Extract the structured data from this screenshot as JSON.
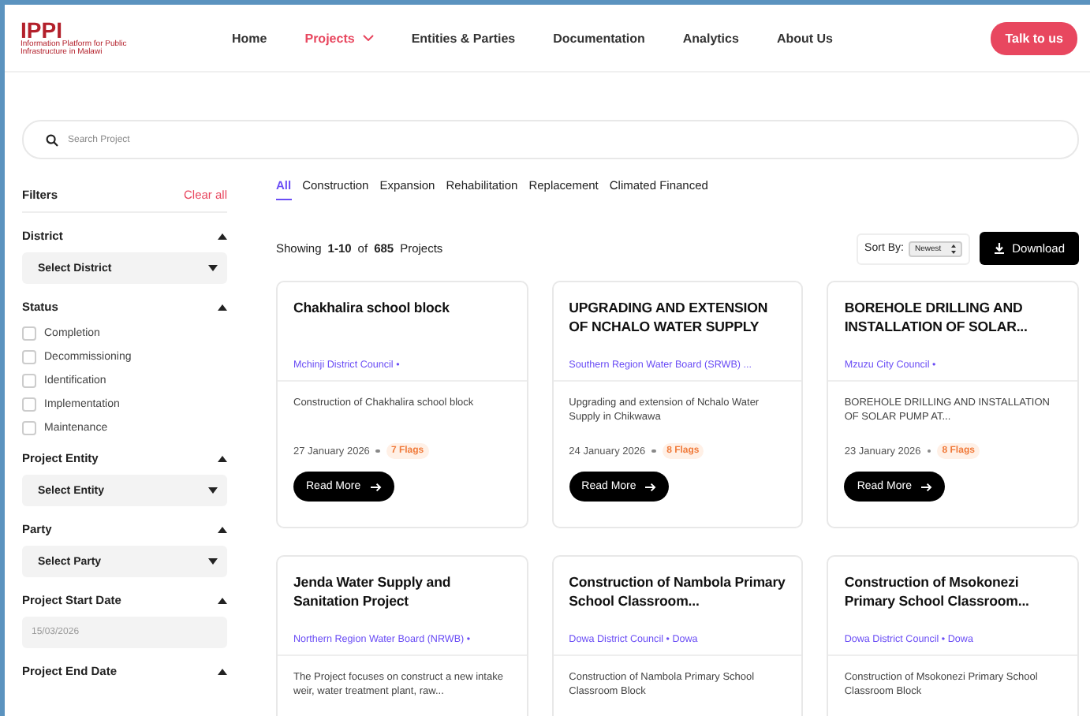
{
  "header": {
    "logo": "IPPI",
    "logo_tagline": "Information Platform for Public Infrastructure in Malawi",
    "nav": [
      {
        "label": "Home",
        "selected": false,
        "dropdown": false
      },
      {
        "label": "Projects",
        "selected": true,
        "dropdown": true
      },
      {
        "label": "Entities & Parties",
        "selected": false,
        "dropdown": false
      },
      {
        "label": "Documentation",
        "selected": false,
        "dropdown": false
      },
      {
        "label": "Analytics",
        "selected": false,
        "dropdown": false
      },
      {
        "label": "About Us",
        "selected": false,
        "dropdown": false
      }
    ],
    "cta": "Talk to us"
  },
  "search": {
    "placeholder": "Search Project"
  },
  "filters": {
    "title": "Filters",
    "clear": "Clear all",
    "sections": [
      {
        "title": "District",
        "expanded": true,
        "kind": "select",
        "value": "Select District"
      },
      {
        "title": "Status",
        "expanded": true,
        "kind": "checkboxes",
        "options": [
          {
            "label": "Completion",
            "checked": false
          },
          {
            "label": "Decommissioning",
            "checked": false
          },
          {
            "label": "Identification",
            "checked": false
          },
          {
            "label": "Implementation",
            "checked": false
          },
          {
            "label": "Maintenance",
            "checked": false
          }
        ]
      },
      {
        "title": "Project Entity",
        "expanded": true,
        "kind": "select",
        "value": "Select Entity"
      },
      {
        "title": "Party",
        "expanded": true,
        "kind": "select",
        "value": "Select Party"
      },
      {
        "title": "Project Start Date",
        "expanded": true,
        "kind": "date",
        "placeholder": "15/03/2026"
      },
      {
        "title": "Project End Date",
        "expanded": true,
        "kind": "date"
      }
    ]
  },
  "tabs": [
    {
      "label": "All",
      "selected": true
    },
    {
      "label": "Construction",
      "selected": false
    },
    {
      "label": "Expansion",
      "selected": false
    },
    {
      "label": "Rehabilitation",
      "selected": false
    },
    {
      "label": "Replacement",
      "selected": false
    },
    {
      "label": "Climated Financed",
      "selected": false
    }
  ],
  "summary": {
    "prefix": "Showing",
    "range": "1-10",
    "of": "of",
    "total": "685",
    "suffix": "Projects"
  },
  "sort": {
    "label": "Sort By:",
    "value": "Newest"
  },
  "download": "Download",
  "cards": [
    {
      "title": "Chakhalira school block",
      "org": "Mchinji District Council •",
      "description": "Construction of Chakhalira school block",
      "date": "27 January 2026",
      "flags": "7 Flags",
      "button": "Read More"
    },
    {
      "title": "UPGRADING AND EXTENSION OF NCHALO WATER SUPPLY",
      "org": "Southern Region Water Board (SRWB) ...",
      "description": "Upgrading and extension of Nchalo Water Supply in Chikwawa",
      "date": "24 January 2026",
      "flags": "8 Flags",
      "button": "Read More"
    },
    {
      "title": "BOREHOLE DRILLING AND INSTALLATION OF SOLAR...",
      "org": "Mzuzu City Council •",
      "description": "BOREHOLE DRILLING AND INSTALLATION OF SOLAR PUMP AT...",
      "date": "23 January 2026",
      "flags": "8 Flags",
      "button": "Read More"
    },
    {
      "title": "Jenda Water Supply and Sanitation Project",
      "org": "Northern Region Water Board (NRWB) •",
      "description": "The Project focuses on construct a new intake weir, water treatment plant, raw..."
    },
    {
      "title": "Construction of Nambola Primary School Classroom...",
      "org": "Dowa District Council • Dowa",
      "description": "Construction of Nambola Primary School Classroom Block"
    },
    {
      "title": "Construction of Msokonezi Primary School Classroom...",
      "org": "Dowa District Council • Dowa",
      "description": "Construction of Msokonezi Primary School Classroom Block"
    }
  ]
}
